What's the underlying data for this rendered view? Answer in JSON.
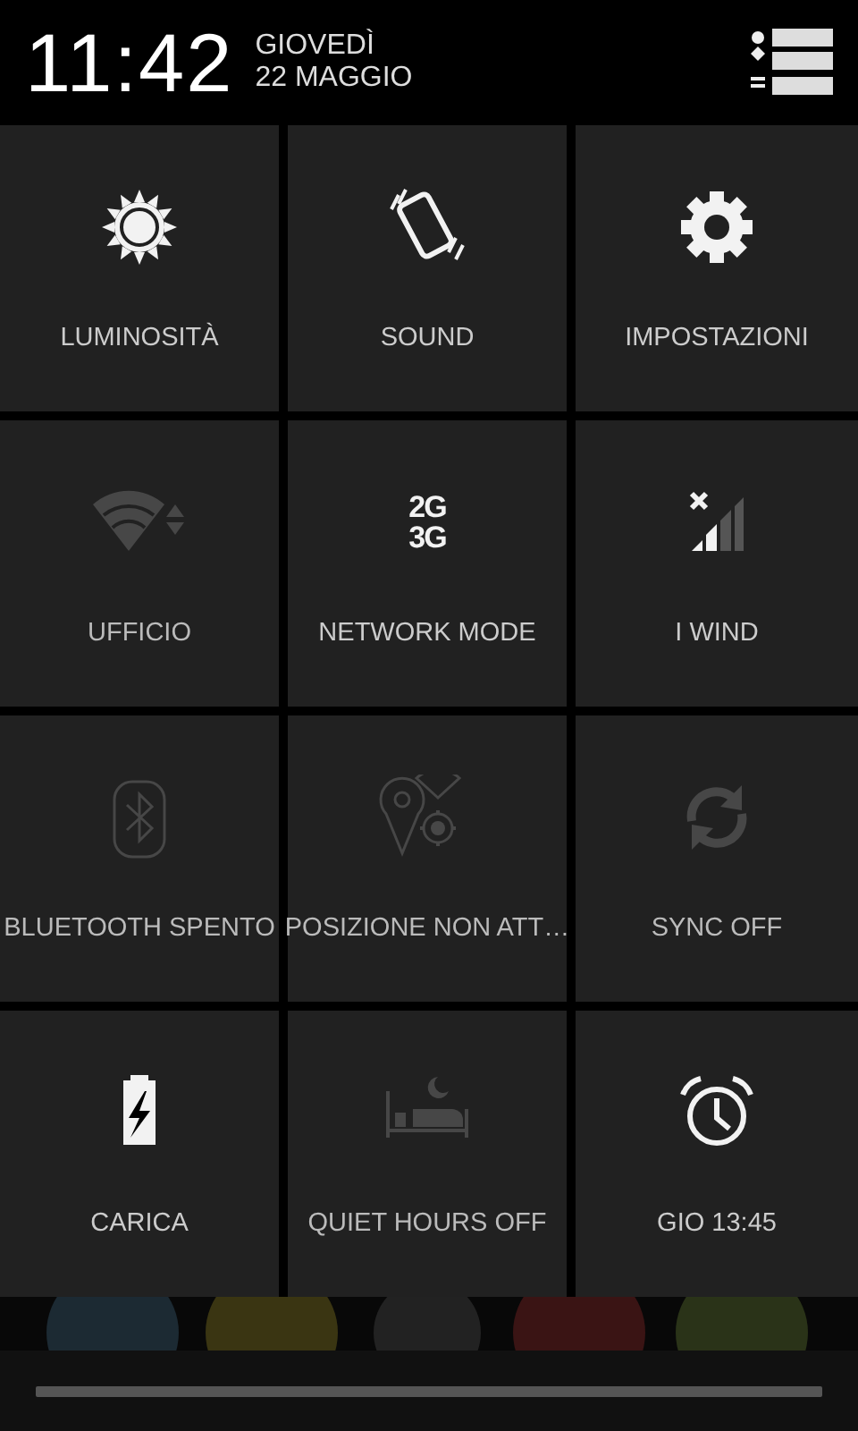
{
  "header": {
    "time": "11:42",
    "day": "GIOVEDÌ",
    "date": "22 MAGGIO"
  },
  "rows": [
    {
      "tiles": [
        {
          "label": "LUMINOSITÀ",
          "kind": "brightness",
          "on": true
        },
        {
          "label": "SOUND",
          "kind": "vibrate",
          "on": true
        },
        {
          "label": "IMPOSTAZIONI",
          "kind": "settings",
          "on": true
        }
      ]
    },
    {
      "tiles": [
        {
          "label": "UFFICIO",
          "kind": "wifi",
          "on": false
        },
        {
          "label": "NETWORK MODE",
          "kind": "network",
          "on": true,
          "icon_text": [
            "2G",
            "3G"
          ]
        },
        {
          "label": "I WIND",
          "kind": "signal",
          "on": true
        }
      ]
    },
    {
      "tiles": [
        {
          "label": "BLUETOOTH SPENTO",
          "kind": "bluetooth",
          "on": false
        },
        {
          "label": "POSIZIONE NON ATT…",
          "kind": "location",
          "on": false
        },
        {
          "label": "SYNC OFF",
          "kind": "sync",
          "on": false
        }
      ]
    },
    {
      "tiles": [
        {
          "label": "CARICA",
          "kind": "battery",
          "on": true
        },
        {
          "label": "QUIET HOURS OFF",
          "kind": "quiet",
          "on": false
        },
        {
          "label": "GIO 13:45",
          "kind": "alarm",
          "on": true
        }
      ]
    }
  ]
}
